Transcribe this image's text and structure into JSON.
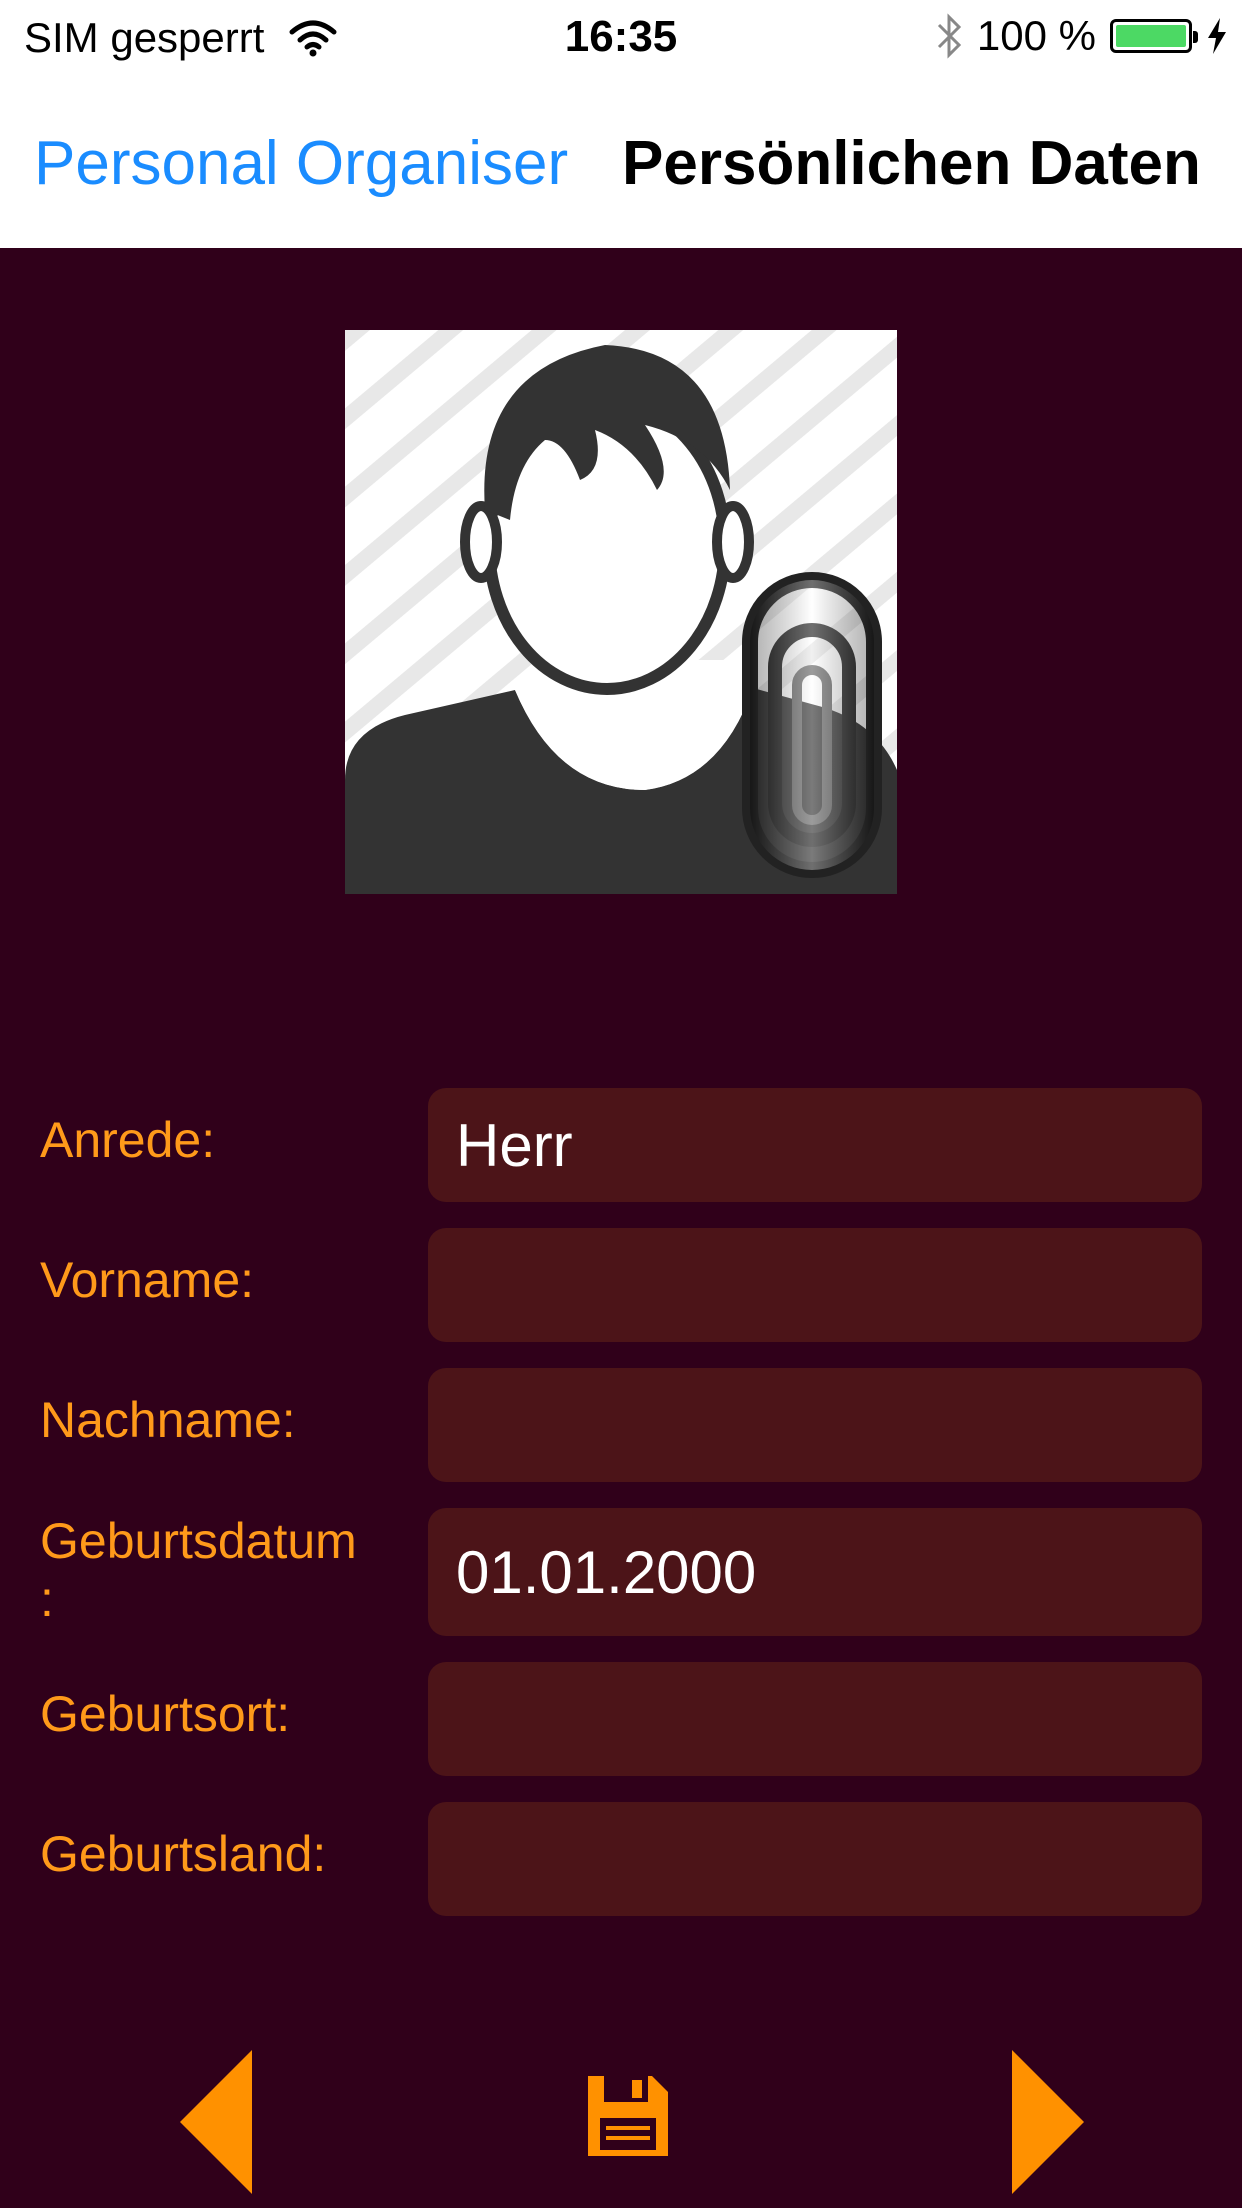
{
  "status_bar": {
    "carrier": "SIM gesperrt",
    "time": "16:35",
    "battery": "100 %",
    "icons": [
      "wifi-icon",
      "bluetooth-icon",
      "battery-icon",
      "charging-bolt-icon"
    ]
  },
  "nav": {
    "back_label": "Personal Organiser",
    "title": "Persönlichen Daten"
  },
  "photo": {
    "icon": "person-placeholder-icon",
    "attachment_icon": "paperclip-icon"
  },
  "form": {
    "fields": [
      {
        "label": "Anrede:",
        "value": "Herr"
      },
      {
        "label": "Vorname:",
        "value": ""
      },
      {
        "label": "Nachname:",
        "value": ""
      },
      {
        "label": "Geburtsdatum\n:",
        "value": "01.01.2000"
      },
      {
        "label": "Geburtsort:",
        "value": ""
      },
      {
        "label": "Geburtsland:",
        "value": ""
      }
    ]
  },
  "toolbar": {
    "icons": [
      "triangle-left-icon",
      "floppy-disk-icon",
      "triangle-right-icon"
    ]
  },
  "colors": {
    "background": "#30001a",
    "field_background": "#4c1418",
    "label": "#ff9a1a",
    "accent_blue": "#1a8cff",
    "icon_orange": "#ff9100"
  }
}
